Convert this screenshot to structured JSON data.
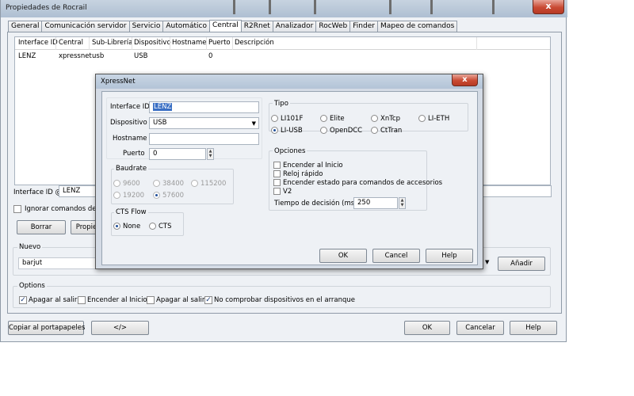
{
  "window": {
    "title": "Propiedades de Rocrail",
    "close": "x"
  },
  "tabs": [
    {
      "label": "General"
    },
    {
      "label": "Comunicación servidor"
    },
    {
      "label": "Servicio"
    },
    {
      "label": "Automático"
    },
    {
      "label": "Central"
    },
    {
      "label": "R2Rnet"
    },
    {
      "label": "Analizador"
    },
    {
      "label": "RocWeb"
    },
    {
      "label": "Finder"
    },
    {
      "label": "Mapeo de comandos"
    }
  ],
  "table": {
    "columns": [
      "Interface ID",
      "Central",
      "Sub-Librería",
      "Dispositivo",
      "Hostname",
      "Puerto",
      "Descripción"
    ],
    "rows": [
      [
        "LENZ",
        "xpressnet",
        "usb",
        "USB",
        "",
        "0",
        ""
      ]
    ]
  },
  "central": {
    "iid_label": "Interface ID @",
    "iid_value": "LENZ",
    "ignore_label": "Ignorar comandos de enc",
    "delete_button": "Borrar",
    "props_button": "Propie",
    "nuevo_title": "Nuevo",
    "nuevo_value": "barjut",
    "add_button": "Añadir"
  },
  "options": {
    "title": "Options",
    "items": [
      {
        "label": "Apagar al salir",
        "checked": true
      },
      {
        "label": "Encender al Inicio",
        "checked": false
      },
      {
        "label": "Apagar al salir",
        "checked": false
      },
      {
        "label": "No comprobar dispositivos en el arranque",
        "checked": true
      }
    ]
  },
  "footer": {
    "copy_button": "Copiar al portapapeles",
    "code_button": "</>",
    "ok_button": "OK",
    "cancel_button": "Cancelar",
    "help_button": "Help"
  },
  "dialog": {
    "title": "XpressNet",
    "close": "x",
    "iid_label": "Interface ID",
    "iid_value": "LENZ",
    "device_label": "Dispositivo",
    "device_value": "USB",
    "hostname_label": "Hostname",
    "hostname_value": "",
    "port_label": "Puerto",
    "port_value": "0",
    "baud_title": "Baudrate",
    "baud_options": [
      {
        "label": "9600",
        "selected": false
      },
      {
        "label": "38400",
        "selected": false
      },
      {
        "label": "115200",
        "selected": false
      },
      {
        "label": "19200",
        "selected": false
      },
      {
        "label": "57600",
        "selected": true
      }
    ],
    "cts_title": "CTS Flow",
    "cts_options": [
      {
        "label": "None",
        "selected": true
      },
      {
        "label": "CTS",
        "selected": false
      }
    ],
    "type_title": "Tipo",
    "type_options": [
      {
        "label": "LI101F",
        "selected": false
      },
      {
        "label": "Elite",
        "selected": false
      },
      {
        "label": "XnTcp",
        "selected": false
      },
      {
        "label": "LI-ETH",
        "selected": false
      },
      {
        "label": "LI-USB",
        "selected": true
      },
      {
        "label": "OpenDCC",
        "selected": false
      },
      {
        "label": "CtTran",
        "selected": false
      }
    ],
    "opts_title": "Opciones",
    "opts": [
      {
        "label": "Encender al Inicio",
        "checked": false
      },
      {
        "label": "Reloj rápido",
        "checked": false
      },
      {
        "label": "Encender estado para comandos de accesorios",
        "checked": false
      },
      {
        "label": "V2",
        "checked": false
      }
    ],
    "decision_label": "Tiempo de decisión (ms)",
    "decision_value": "250",
    "ok_button": "OK",
    "cancel_button": "Cancel",
    "help_button": "Help"
  }
}
